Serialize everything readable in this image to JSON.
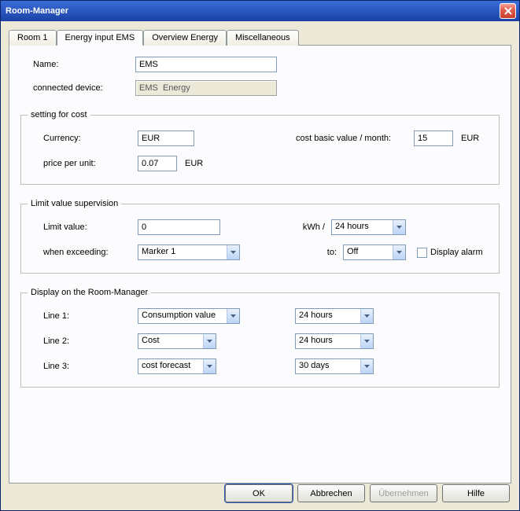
{
  "window": {
    "title": "Room-Manager"
  },
  "tabs": {
    "room1": "Room 1",
    "energy": "Energy input EMS",
    "overview": "Overview Energy",
    "misc": "Miscellaneous"
  },
  "fields": {
    "name_label": "Name:",
    "name_value": "EMS",
    "device_label": "connected device:",
    "device_value": "EMS  Energy"
  },
  "cost": {
    "legend": "setting for cost",
    "currency_label": "Currency:",
    "currency_value": "EUR",
    "basic_label": "cost basic value / month:",
    "basic_value": "15",
    "basic_unit": "EUR",
    "ppu_label": "price per unit:",
    "ppu_value": "0.07",
    "ppu_unit": "EUR"
  },
  "limit": {
    "legend": "Limit value supervision",
    "limit_label": "Limit value:",
    "limit_value": "0",
    "kwh_label": "kWh /",
    "kwh_select": "24 hours",
    "exceed_label": "when exceeding:",
    "exceed_select": "Marker 1",
    "to_label": "to:",
    "to_select": "Off",
    "alarm_label": "Display alarm"
  },
  "display": {
    "legend": "Display on the Room-Manager",
    "line1_label": "Line 1:",
    "line1_a": "Consumption value",
    "line1_b": "24 hours",
    "line2_label": "Line 2:",
    "line2_a": "Cost",
    "line2_b": "24 hours",
    "line3_label": "Line 3:",
    "line3_a": "cost forecast",
    "line3_b": "30 days"
  },
  "buttons": {
    "ok": "OK",
    "cancel": "Abbrechen",
    "apply": "Übernehmen",
    "help": "Hilfe"
  }
}
